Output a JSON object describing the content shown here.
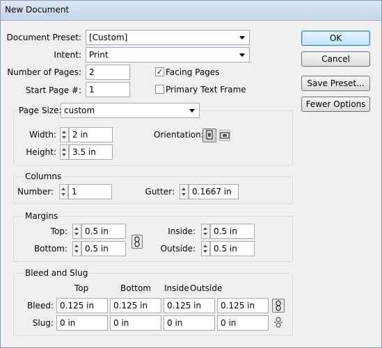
{
  "window": {
    "title": "New Document"
  },
  "document_preset": {
    "label": "Document Preset:",
    "value": "[Custom]"
  },
  "intent": {
    "label": "Intent:",
    "value": "Print"
  },
  "number_of_pages": {
    "label": "Number of Pages:",
    "value": "2"
  },
  "start_page": {
    "label": "Start Page #:",
    "value": "1"
  },
  "facing_pages": {
    "label": "Facing Pages",
    "checked": true
  },
  "primary_text_frame": {
    "label": "Primary Text Frame",
    "checked": false
  },
  "buttons": {
    "ok": "OK",
    "cancel": "Cancel",
    "save_preset": "Save Preset...",
    "fewer_options": "Fewer Options"
  },
  "page_size": {
    "label": "Page Size:",
    "value": "custom",
    "width_label": "Width:",
    "width": "2 in",
    "height_label": "Height:",
    "height": "3.5 in",
    "orientation_label": "Orientation:",
    "orientation_selected": "portrait"
  },
  "columns": {
    "title": "Columns",
    "number_label": "Number:",
    "number": "1",
    "gutter_label": "Gutter:",
    "gutter": "0.1667 in"
  },
  "margins": {
    "title": "Margins",
    "top_label": "Top:",
    "top": "0.5 in",
    "bottom_label": "Bottom:",
    "bottom": "0.5 in",
    "inside_label": "Inside:",
    "inside": "0.5 in",
    "outside_label": "Outside:",
    "outside": "0.5 in"
  },
  "bleed_slug": {
    "title": "Bleed and Slug",
    "headers": [
      "Top",
      "Bottom",
      "Inside",
      "Outside"
    ],
    "bleed_label": "Bleed:",
    "bleed": [
      "0.125 in",
      "0.125 in",
      "0.125 in",
      "0.125 in"
    ],
    "slug_label": "Slug:",
    "slug": [
      "0 in",
      "0 in",
      "0 in",
      "0 in"
    ]
  }
}
